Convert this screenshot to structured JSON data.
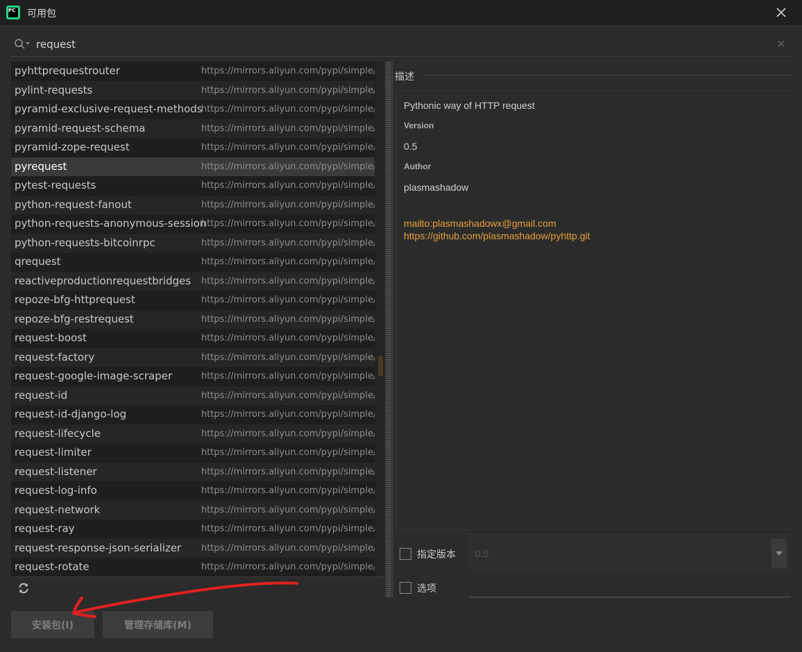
{
  "window": {
    "title": "可用包",
    "app_icon_text": "PC"
  },
  "search": {
    "value": "request"
  },
  "packages": [
    {
      "name": "pyhttprequestrouter",
      "repo": "https://mirrors.aliyun.com/pypi/simple/"
    },
    {
      "name": "pylint-requests",
      "repo": "https://mirrors.aliyun.com/pypi/simple/"
    },
    {
      "name": "pyramid-exclusive-request-methods",
      "repo": "https://mirrors.aliyun.com/pypi/simple/"
    },
    {
      "name": "pyramid-request-schema",
      "repo": "https://mirrors.aliyun.com/pypi/simple/"
    },
    {
      "name": "pyramid-zope-request",
      "repo": "https://mirrors.aliyun.com/pypi/simple/"
    },
    {
      "name": "pyrequest",
      "repo": "https://mirrors.aliyun.com/pypi/simple/",
      "selected": true
    },
    {
      "name": "pytest-requests",
      "repo": "https://mirrors.aliyun.com/pypi/simple/"
    },
    {
      "name": "python-request-fanout",
      "repo": "https://mirrors.aliyun.com/pypi/simple/"
    },
    {
      "name": "python-requests-anonymous-session",
      "repo": "https://mirrors.aliyun.com/pypi/simple/"
    },
    {
      "name": "python-requests-bitcoinrpc",
      "repo": "https://mirrors.aliyun.com/pypi/simple/"
    },
    {
      "name": "qrequest",
      "repo": "https://mirrors.aliyun.com/pypi/simple/"
    },
    {
      "name": "reactiveproductionrequestbridges",
      "repo": "https://mirrors.aliyun.com/pypi/simple/"
    },
    {
      "name": "repoze-bfg-httprequest",
      "repo": "https://mirrors.aliyun.com/pypi/simple/"
    },
    {
      "name": "repoze-bfg-restrequest",
      "repo": "https://mirrors.aliyun.com/pypi/simple/"
    },
    {
      "name": "request-boost",
      "repo": "https://mirrors.aliyun.com/pypi/simple/"
    },
    {
      "name": "request-factory",
      "repo": "https://mirrors.aliyun.com/pypi/simple/"
    },
    {
      "name": "request-google-image-scraper",
      "repo": "https://mirrors.aliyun.com/pypi/simple/"
    },
    {
      "name": "request-id",
      "repo": "https://mirrors.aliyun.com/pypi/simple/"
    },
    {
      "name": "request-id-django-log",
      "repo": "https://mirrors.aliyun.com/pypi/simple/"
    },
    {
      "name": "request-lifecycle",
      "repo": "https://mirrors.aliyun.com/pypi/simple/"
    },
    {
      "name": "request-limiter",
      "repo": "https://mirrors.aliyun.com/pypi/simple/"
    },
    {
      "name": "request-listener",
      "repo": "https://mirrors.aliyun.com/pypi/simple/"
    },
    {
      "name": "request-log-info",
      "repo": "https://mirrors.aliyun.com/pypi/simple/"
    },
    {
      "name": "request-network",
      "repo": "https://mirrors.aliyun.com/pypi/simple/"
    },
    {
      "name": "request-ray",
      "repo": "https://mirrors.aliyun.com/pypi/simple/"
    },
    {
      "name": "request-response-json-serializer",
      "repo": "https://mirrors.aliyun.com/pypi/simple/"
    },
    {
      "name": "request-rotate",
      "repo": "https://mirrors.aliyun.com/pypi/simple/"
    }
  ],
  "description": {
    "header": "描述",
    "summary": "Pythonic way of HTTP request",
    "version_label": "Version",
    "version_value": "0.5",
    "author_label": "Author",
    "author_value": "plasmashadow",
    "email_link": "mailto:plasmashadowx@gmail.com",
    "homepage_link": "https://github.com/plasmashadow/pyhttp.git"
  },
  "options": {
    "specify_version_label": "指定版本",
    "specify_version_value": "0.5",
    "options_label": "选项"
  },
  "buttons": {
    "install_label": "安装包(I)",
    "manage_repos_label": "管理存储库(M)"
  },
  "colors": {
    "background": "#2b2b2b",
    "link": "#e6a03a",
    "selection": "#3a3a3a",
    "annotation": "#e02020"
  }
}
